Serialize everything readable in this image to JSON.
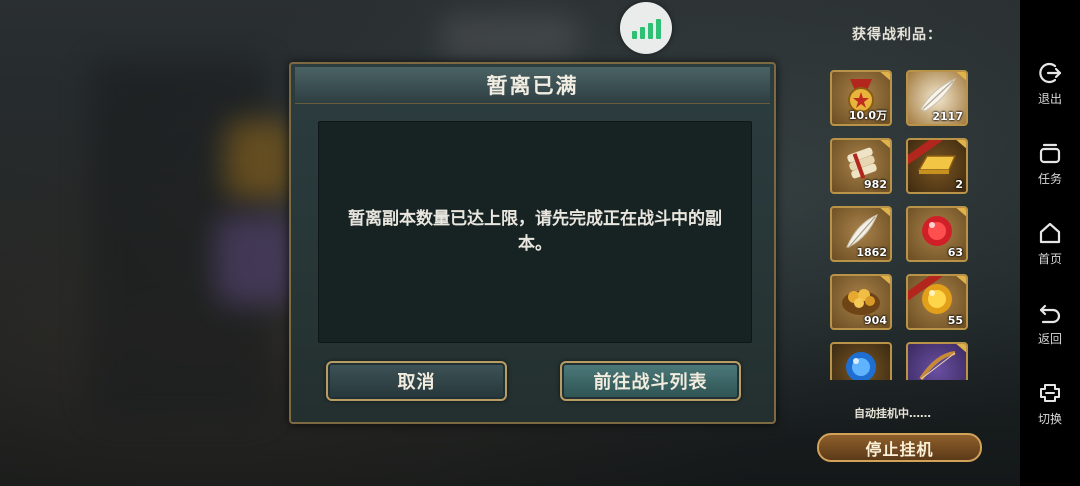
{
  "dialog": {
    "title": "暂离已满",
    "message": "暂离副本数量已达上限，请先完成正在战斗中的副本。",
    "cancel_label": "取消",
    "go_label": "前往战斗列表"
  },
  "loot": {
    "title": "获得战利品：",
    "items": [
      {
        "icon": "gold-medal-icon",
        "count": "10.0万"
      },
      {
        "icon": "silver-feather-icon",
        "count": "2117"
      },
      {
        "icon": "scroll-bundle-icon",
        "count": "982"
      },
      {
        "icon": "gold-bar-icon",
        "count": "2"
      },
      {
        "icon": "white-feather-icon",
        "count": "1862"
      },
      {
        "icon": "red-orb-icon",
        "count": "63"
      },
      {
        "icon": "gold-nugget-pouch-icon",
        "count": "904"
      },
      {
        "icon": "yellow-orb-icon",
        "count": "55"
      },
      {
        "icon": "blue-orb-icon",
        "count": ""
      },
      {
        "icon": "purple-bow-icon",
        "count": ""
      }
    ],
    "auto_status": "自动挂机中……",
    "stop_label": "停止挂机"
  },
  "side_nav": {
    "items": [
      {
        "icon": "exit-icon",
        "label": "退出"
      },
      {
        "icon": "task-icon",
        "label": "任务"
      },
      {
        "icon": "home-icon",
        "label": "首页"
      },
      {
        "icon": "back-icon",
        "label": "返回"
      },
      {
        "icon": "switch-icon",
        "label": "切换"
      }
    ]
  },
  "colors": {
    "frame_gold": "#b79c63",
    "signal_green": "#2fbf75",
    "stop_button": "#8e5f2b"
  }
}
